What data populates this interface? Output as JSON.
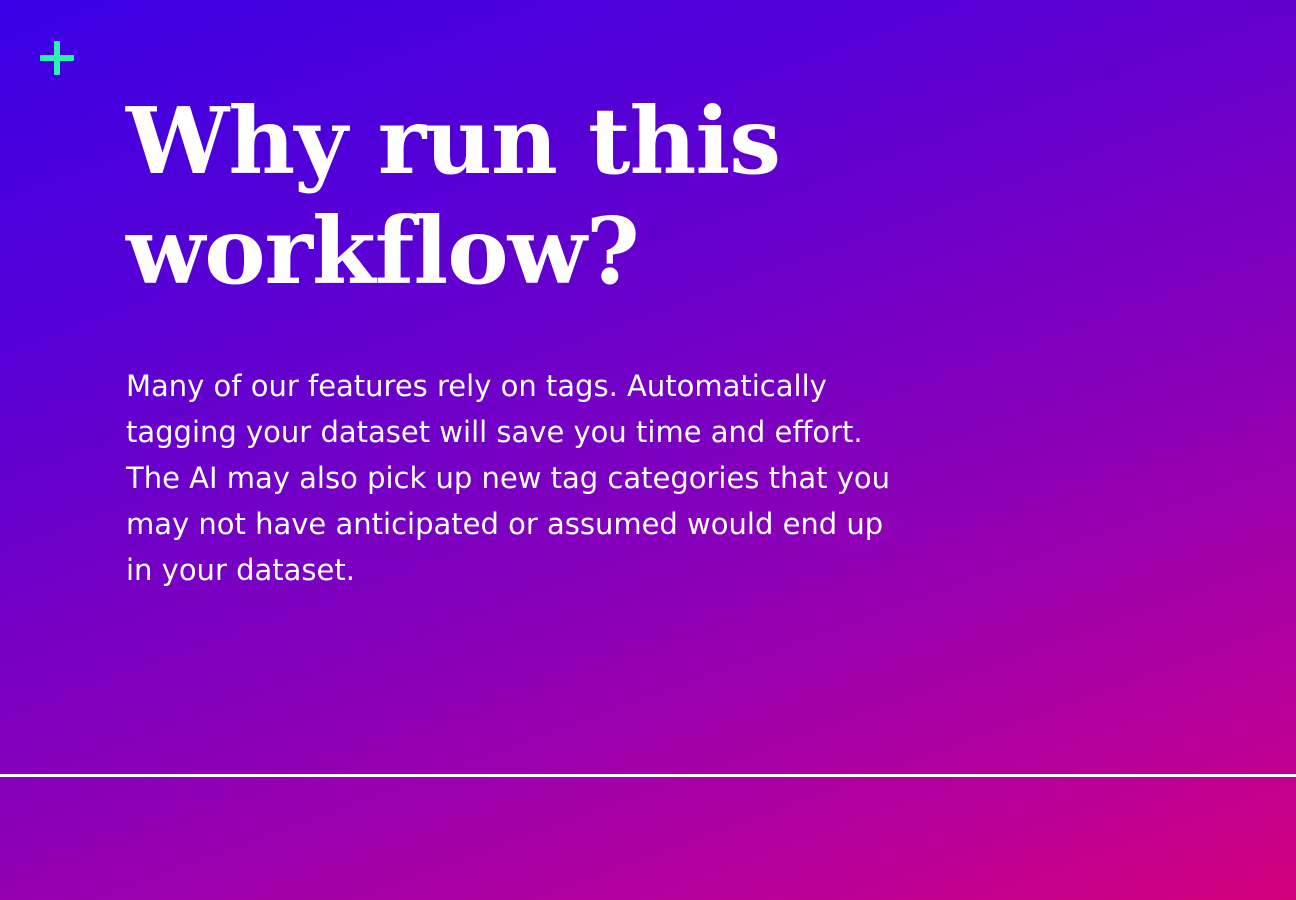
{
  "slide": {
    "title_lines": [
      "Why run this",
      "workflow?"
    ],
    "body_lines": [
      "Many of our features rely on tags. Automatically",
      "tagging your dataset will save you time and effort.",
      "The AI may also pick up new tag categories that you",
      "may not have anticipated or assumed would end up",
      "in your dataset."
    ],
    "icon": "plus-icon",
    "colors": {
      "accent": "#2ef0b0",
      "gradient_start": "#3a00e6",
      "gradient_end": "#d3007c",
      "text": "#ffffff"
    }
  }
}
